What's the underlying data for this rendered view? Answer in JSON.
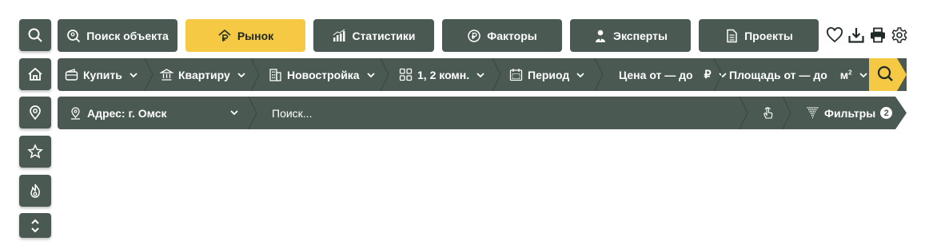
{
  "colors": {
    "panel": "#4a5a53",
    "accent": "#f6c945",
    "text": "#ffffff"
  },
  "tabs": [
    {
      "label": "Поиск объекта",
      "icon": "search-pin-icon"
    },
    {
      "label": "Рынок",
      "icon": "ruble-house-icon",
      "active": true
    },
    {
      "label": "Статистики",
      "icon": "bar-chart-icon"
    },
    {
      "label": "Факторы",
      "icon": "ruble-coin-icon"
    },
    {
      "label": "Эксперты",
      "icon": "person-icon"
    },
    {
      "label": "Проекты",
      "icon": "document-icon"
    }
  ],
  "tools": [
    "heart-icon",
    "download-icon",
    "print-icon",
    "gear-icon"
  ],
  "sidebar": [
    "search-icon",
    "home-icon",
    "location-pin-icon",
    "star-icon",
    "fire-icon",
    "expand-collapse-icon"
  ],
  "filters": {
    "deal": "Купить",
    "property": "Квартиру",
    "category": "Новостройка",
    "rooms": "1, 2 комн.",
    "period": "Период",
    "price": "Цена от — до",
    "price_unit": "₽",
    "area": "Площадь от — до",
    "area_unit": "м",
    "area_unit_sup": "2"
  },
  "address": {
    "label": "Адрес: г. Омск",
    "search_placeholder": "Поиск...",
    "filters_label": "Фильтры",
    "filters_count": "2"
  }
}
